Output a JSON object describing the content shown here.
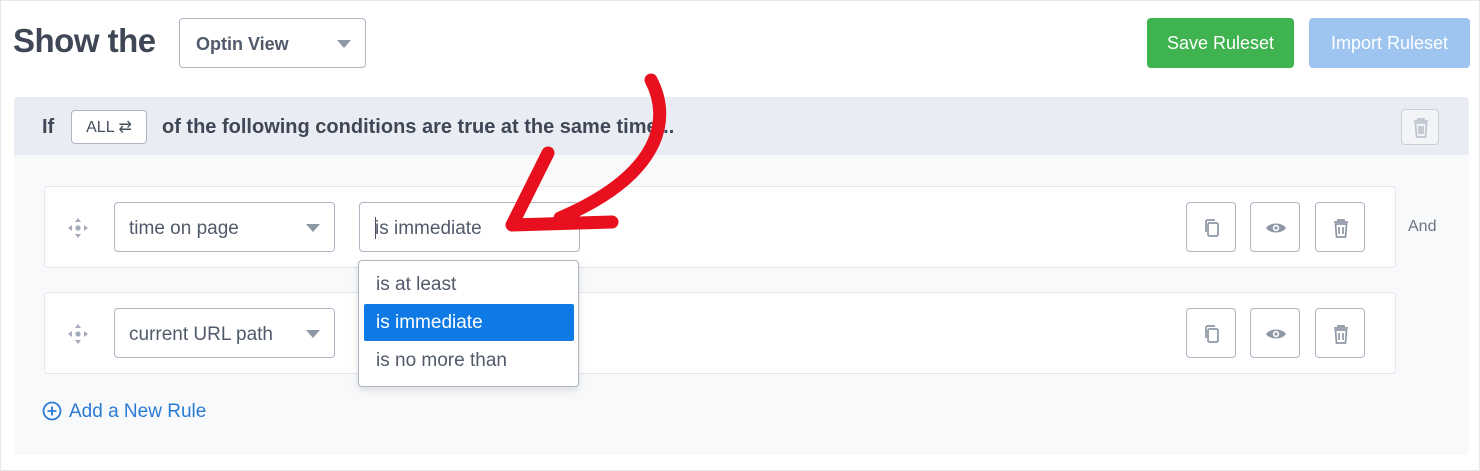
{
  "header": {
    "title": "Show the",
    "view_select": "Optin View",
    "save_label": "Save Ruleset",
    "import_label": "Import Ruleset"
  },
  "ruleset": {
    "if_label": "If",
    "match_toggle": "ALL ⇄",
    "condition_text": "of the following conditions are true at the same time..."
  },
  "rules": [
    {
      "field": "time on page",
      "operator": "is immediate"
    },
    {
      "field": "current URL path",
      "operator": ""
    }
  ],
  "and_label": "And",
  "add_rule_label": "Add a New Rule",
  "dropdown": {
    "options": [
      "is at least",
      "is immediate",
      "is no more than"
    ],
    "selected": "is immediate"
  },
  "colors": {
    "save": "#3fb34f",
    "import": "#9ec5f0",
    "link": "#2b7ad3",
    "selected_option": "#0f7ae5",
    "annotation_arrow": "#e8101e"
  },
  "icons": {
    "drag": "drag-handle-icon",
    "copy": "copy-icon",
    "preview": "eye-icon",
    "delete": "trash-icon",
    "add": "plus-circle-icon",
    "annotation": "red-arrow"
  }
}
